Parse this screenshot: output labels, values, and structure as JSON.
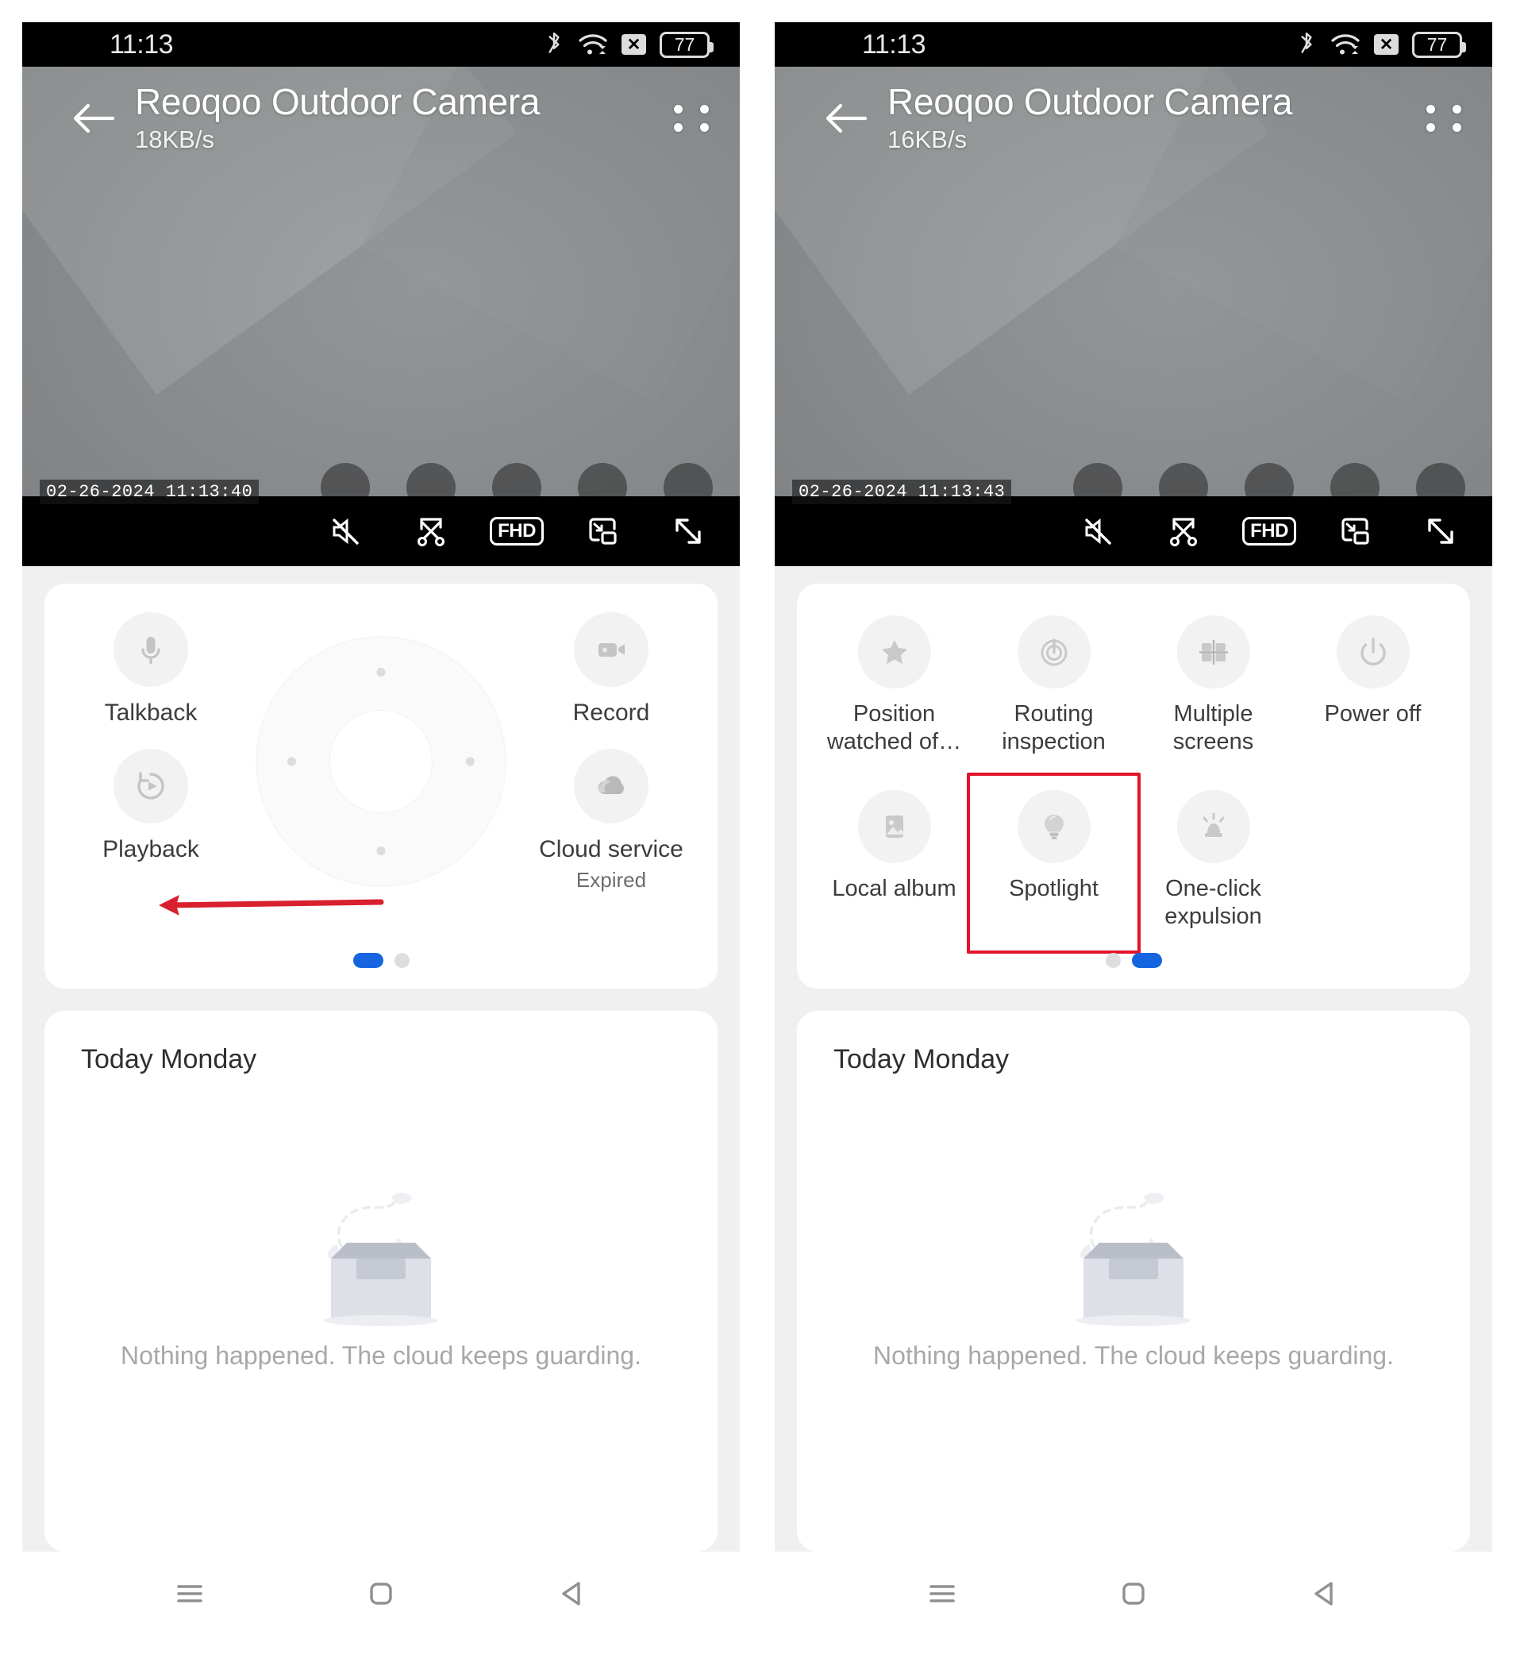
{
  "screens": [
    {
      "id": "screen-left",
      "status": {
        "time": "11:13",
        "bluetooth_icon": "bluetooth-icon",
        "wifi_icon": "wifi-icon",
        "sim_icon": "sim-disabled-icon",
        "sim_glyph": "✕",
        "battery_percent": "77"
      },
      "player": {
        "back_icon": "back-arrow-icon",
        "title": "Reoqoo Outdoor Camera",
        "bitrate": "18KB/s",
        "menu_icon": "four-dot-menu-icon",
        "timestamp": "02-26-2024  11:13:40",
        "controls": [
          {
            "name": "mute-toggle",
            "icon": "speaker-muted-icon",
            "label": ""
          },
          {
            "name": "clip-button",
            "icon": "scissors-icon",
            "label": ""
          },
          {
            "name": "quality-button",
            "icon": "fhd-badge-icon",
            "label": "FHD"
          },
          {
            "name": "pip-button",
            "icon": "picture-in-picture-icon",
            "label": ""
          },
          {
            "name": "fullscreen-button",
            "icon": "expand-arrows-icon",
            "label": ""
          }
        ]
      },
      "control_panel": {
        "page": 1,
        "dpad_name": "ptz-directional-pad",
        "buttons": [
          {
            "name": "talkback-button",
            "icon": "microphone-icon",
            "label": "Talkback",
            "sub": "",
            "position": "top-left"
          },
          {
            "name": "record-button",
            "icon": "video-camera-icon",
            "label": "Record",
            "sub": "",
            "position": "top-right"
          },
          {
            "name": "playback-button",
            "icon": "playback-history-icon",
            "label": "Playback",
            "sub": "",
            "position": "bottom-left"
          },
          {
            "name": "cloud-service-button",
            "icon": "cloud-icon",
            "label": "Cloud service",
            "sub": "Expired",
            "position": "bottom-right"
          }
        ],
        "dots": [
          {
            "active": true
          },
          {
            "active": false
          }
        ],
        "annotation": {
          "type": "arrow",
          "direction": "left",
          "color": "#d8202f"
        }
      },
      "events": {
        "title": "Today Monday",
        "empty_icon": "empty-inbox-icon",
        "empty_text": "Nothing happened. The cloud keeps guarding."
      },
      "navbar": [
        {
          "name": "nav-recents-button",
          "icon": "hamburger-icon"
        },
        {
          "name": "nav-home-button",
          "icon": "square-icon"
        },
        {
          "name": "nav-back-button",
          "icon": "triangle-back-icon"
        }
      ]
    },
    {
      "id": "screen-right",
      "status": {
        "time": "11:13",
        "bluetooth_icon": "bluetooth-icon",
        "wifi_icon": "wifi-icon",
        "sim_icon": "sim-disabled-icon",
        "sim_glyph": "✕",
        "battery_percent": "77"
      },
      "player": {
        "back_icon": "back-arrow-icon",
        "title": "Reoqoo Outdoor Camera",
        "bitrate": "16KB/s",
        "menu_icon": "four-dot-menu-icon",
        "timestamp": "02-26-2024  11:13:43",
        "controls": [
          {
            "name": "mute-toggle",
            "icon": "speaker-muted-icon",
            "label": ""
          },
          {
            "name": "clip-button",
            "icon": "scissors-icon",
            "label": ""
          },
          {
            "name": "quality-button",
            "icon": "fhd-badge-icon",
            "label": "FHD"
          },
          {
            "name": "pip-button",
            "icon": "picture-in-picture-icon",
            "label": ""
          },
          {
            "name": "fullscreen-button",
            "icon": "expand-arrows-icon",
            "label": ""
          }
        ]
      },
      "control_panel": {
        "page": 2,
        "buttons": [
          {
            "name": "position-watched-button",
            "icon": "star-icon",
            "label": "Position watched of…",
            "highlight": false
          },
          {
            "name": "routing-inspection-button",
            "icon": "routing-dial-icon",
            "label": "Routing inspection",
            "highlight": false
          },
          {
            "name": "multiple-screens-button",
            "icon": "multi-screen-grid-icon",
            "label": "Multiple screens",
            "highlight": false
          },
          {
            "name": "power-off-button",
            "icon": "power-icon",
            "label": "Power off",
            "highlight": false
          },
          {
            "name": "local-album-button",
            "icon": "image-gallery-icon",
            "label": "Local album",
            "highlight": false
          },
          {
            "name": "spotlight-button",
            "icon": "light-bulb-icon",
            "label": "Spotlight",
            "highlight": true
          },
          {
            "name": "one-click-expulsion-button",
            "icon": "siren-alarm-icon",
            "label": "One-click expulsion",
            "highlight": false
          }
        ],
        "dots": [
          {
            "active": false
          },
          {
            "active": true
          }
        ],
        "highlight_color": "#e0152a"
      },
      "events": {
        "title": "Today Monday",
        "empty_icon": "empty-inbox-icon",
        "empty_text": "Nothing happened. The cloud keeps guarding."
      },
      "navbar": [
        {
          "name": "nav-recents-button",
          "icon": "hamburger-icon"
        },
        {
          "name": "nav-home-button",
          "icon": "square-icon"
        },
        {
          "name": "nav-back-button",
          "icon": "triangle-back-icon"
        }
      ]
    }
  ],
  "colors": {
    "accent_blue": "#1565e0",
    "annotation_red": "#d8202f",
    "highlight_red": "#e0152a",
    "page_bg": "#f0f0f0",
    "card_bg": "#ffffff",
    "icon_grey": "#c9c9c9",
    "label_grey": "#3c3c3c"
  }
}
